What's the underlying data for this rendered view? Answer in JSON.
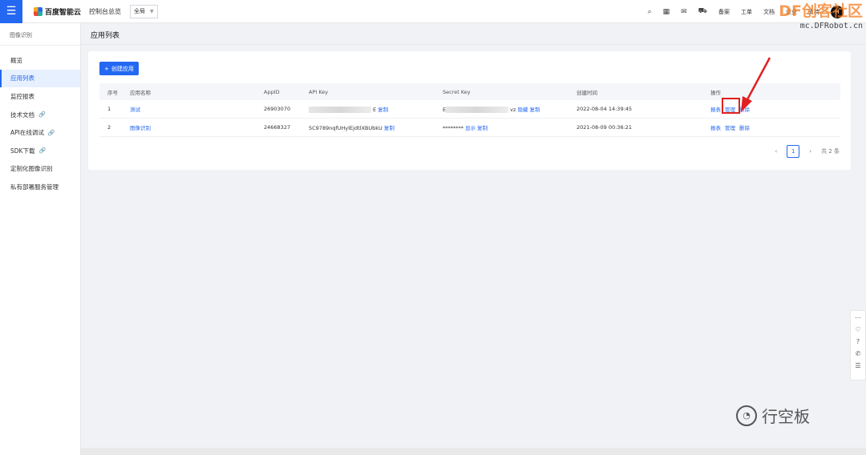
{
  "topbar": {
    "logo_text": "百度智能云",
    "console": "控制台总览",
    "region": "全局",
    "nav_items": [
      "备案",
      "工单",
      "文档",
      "企业",
      "支持"
    ],
    "avatar": "H"
  },
  "watermark": {
    "big": "DF创客社区",
    "small": "mc.DFRobot.cn",
    "bottom": "行空板"
  },
  "sidebar": {
    "title": "图像识别",
    "items": [
      {
        "label": "概览",
        "ext": ""
      },
      {
        "label": "应用列表",
        "ext": ""
      },
      {
        "label": "监控报表",
        "ext": ""
      },
      {
        "label": "技术文档",
        "ext": "🔗"
      },
      {
        "label": "API在线调试",
        "ext": "🔗"
      },
      {
        "label": "SDK下载",
        "ext": "🔗"
      },
      {
        "label": "定制化图像识别",
        "ext": ""
      },
      {
        "label": "私有部署服务管理",
        "ext": ""
      }
    ]
  },
  "page": {
    "title": "应用列表",
    "create_button": "创建应用"
  },
  "table": {
    "headers": [
      "序号",
      "应用名称",
      "AppID",
      "API Key",
      "Secret Key",
      "创建时间",
      "操作"
    ],
    "rows": [
      {
        "idx": "1",
        "name": "测试",
        "appid": "26903070",
        "api_key": "E",
        "api_action": "复制",
        "secret": "E",
        "secret_suffix": "vz",
        "secret_action1": "隐藏",
        "secret_action2": "复制",
        "created": "2022-08-04 14:39:45",
        "ops": [
          "报表",
          "管理",
          "删除"
        ]
      },
      {
        "idx": "2",
        "name": "图像识别",
        "appid": "24668327",
        "api_key": "5C9789nqfUHylEjdtlXBUbkU",
        "api_action": "复制",
        "secret": "********",
        "secret_suffix": "",
        "secret_action1": "显示",
        "secret_action2": "复制",
        "created": "2021-08-09 00:36:21",
        "ops": [
          "报表",
          "管理",
          "删除"
        ]
      }
    ]
  },
  "pager": {
    "prev": "‹",
    "current": "1",
    "next": "›",
    "total": "共 2 条"
  }
}
